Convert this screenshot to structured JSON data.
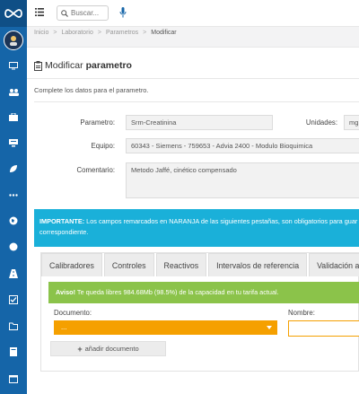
{
  "topbar": {
    "search_placeholder": "Buscar..."
  },
  "breadcrumb": [
    "Inicio",
    "Laboratorio",
    "Parametros",
    "Modificar"
  ],
  "breadcrumb_separator": ">",
  "page": {
    "title_prefix": "Modificar",
    "title_strong": "parametro",
    "helper": "Complete los datos para el parametro."
  },
  "form": {
    "parametro_label": "Parametro:",
    "parametro_value": "Srm-Creatinina",
    "unidades_label": "Unidades:",
    "unidades_value": "mg",
    "equipo_label": "Equipo:",
    "equipo_value": "60343 - Siemens - 759653 - Advia 2400 - Modulo Bioquimica",
    "comentario_label": "Comentario:",
    "comentario_value": "Metodo Jaffé, cinético compensado"
  },
  "info_alert": {
    "strong": "IMPORTANTE:",
    "text_line1": " Los campos remarcados en NARANJA de las siguientes pestañas, son obligatorios para guar",
    "text_line2": "correspondiente."
  },
  "tabs": [
    "Calibradores",
    "Controles",
    "Reactivos",
    "Intervalos de referencia",
    "Validación au"
  ],
  "success_alert": {
    "strong": "Aviso!",
    "text": " Te queda libres 984.68Mb (98.5%) de la capacidad en tu tarifa actual."
  },
  "documents": {
    "documento_label": "Documento:",
    "documento_selected": "...",
    "nombre_label": "Nombre:",
    "add_button": "añadir documento"
  },
  "colors": {
    "sidebar": "#1565a8",
    "info": "#1ab0d9",
    "success": "#8bc34a",
    "required": "#f5a000"
  }
}
